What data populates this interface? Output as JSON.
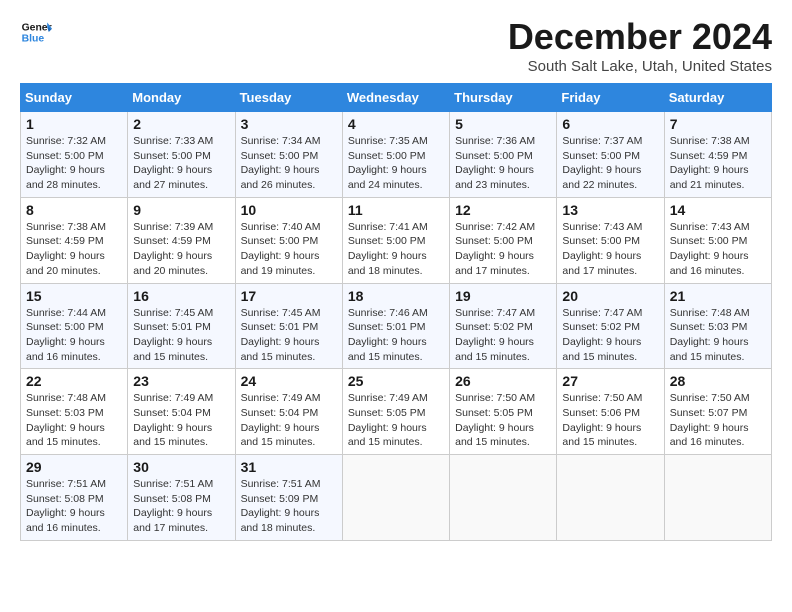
{
  "logo": {
    "line1": "General",
    "line2": "Blue"
  },
  "title": "December 2024",
  "subtitle": "South Salt Lake, Utah, United States",
  "weekdays": [
    "Sunday",
    "Monday",
    "Tuesday",
    "Wednesday",
    "Thursday",
    "Friday",
    "Saturday"
  ],
  "weeks": [
    [
      {
        "day": "1",
        "info": "Sunrise: 7:32 AM\nSunset: 5:00 PM\nDaylight: 9 hours\nand 28 minutes."
      },
      {
        "day": "2",
        "info": "Sunrise: 7:33 AM\nSunset: 5:00 PM\nDaylight: 9 hours\nand 27 minutes."
      },
      {
        "day": "3",
        "info": "Sunrise: 7:34 AM\nSunset: 5:00 PM\nDaylight: 9 hours\nand 26 minutes."
      },
      {
        "day": "4",
        "info": "Sunrise: 7:35 AM\nSunset: 5:00 PM\nDaylight: 9 hours\nand 24 minutes."
      },
      {
        "day": "5",
        "info": "Sunrise: 7:36 AM\nSunset: 5:00 PM\nDaylight: 9 hours\nand 23 minutes."
      },
      {
        "day": "6",
        "info": "Sunrise: 7:37 AM\nSunset: 5:00 PM\nDaylight: 9 hours\nand 22 minutes."
      },
      {
        "day": "7",
        "info": "Sunrise: 7:38 AM\nSunset: 4:59 PM\nDaylight: 9 hours\nand 21 minutes."
      }
    ],
    [
      {
        "day": "8",
        "info": "Sunrise: 7:38 AM\nSunset: 4:59 PM\nDaylight: 9 hours\nand 20 minutes."
      },
      {
        "day": "9",
        "info": "Sunrise: 7:39 AM\nSunset: 4:59 PM\nDaylight: 9 hours\nand 20 minutes."
      },
      {
        "day": "10",
        "info": "Sunrise: 7:40 AM\nSunset: 5:00 PM\nDaylight: 9 hours\nand 19 minutes."
      },
      {
        "day": "11",
        "info": "Sunrise: 7:41 AM\nSunset: 5:00 PM\nDaylight: 9 hours\nand 18 minutes."
      },
      {
        "day": "12",
        "info": "Sunrise: 7:42 AM\nSunset: 5:00 PM\nDaylight: 9 hours\nand 17 minutes."
      },
      {
        "day": "13",
        "info": "Sunrise: 7:43 AM\nSunset: 5:00 PM\nDaylight: 9 hours\nand 17 minutes."
      },
      {
        "day": "14",
        "info": "Sunrise: 7:43 AM\nSunset: 5:00 PM\nDaylight: 9 hours\nand 16 minutes."
      }
    ],
    [
      {
        "day": "15",
        "info": "Sunrise: 7:44 AM\nSunset: 5:00 PM\nDaylight: 9 hours\nand 16 minutes."
      },
      {
        "day": "16",
        "info": "Sunrise: 7:45 AM\nSunset: 5:01 PM\nDaylight: 9 hours\nand 15 minutes."
      },
      {
        "day": "17",
        "info": "Sunrise: 7:45 AM\nSunset: 5:01 PM\nDaylight: 9 hours\nand 15 minutes."
      },
      {
        "day": "18",
        "info": "Sunrise: 7:46 AM\nSunset: 5:01 PM\nDaylight: 9 hours\nand 15 minutes."
      },
      {
        "day": "19",
        "info": "Sunrise: 7:47 AM\nSunset: 5:02 PM\nDaylight: 9 hours\nand 15 minutes."
      },
      {
        "day": "20",
        "info": "Sunrise: 7:47 AM\nSunset: 5:02 PM\nDaylight: 9 hours\nand 15 minutes."
      },
      {
        "day": "21",
        "info": "Sunrise: 7:48 AM\nSunset: 5:03 PM\nDaylight: 9 hours\nand 15 minutes."
      }
    ],
    [
      {
        "day": "22",
        "info": "Sunrise: 7:48 AM\nSunset: 5:03 PM\nDaylight: 9 hours\nand 15 minutes."
      },
      {
        "day": "23",
        "info": "Sunrise: 7:49 AM\nSunset: 5:04 PM\nDaylight: 9 hours\nand 15 minutes."
      },
      {
        "day": "24",
        "info": "Sunrise: 7:49 AM\nSunset: 5:04 PM\nDaylight: 9 hours\nand 15 minutes."
      },
      {
        "day": "25",
        "info": "Sunrise: 7:49 AM\nSunset: 5:05 PM\nDaylight: 9 hours\nand 15 minutes."
      },
      {
        "day": "26",
        "info": "Sunrise: 7:50 AM\nSunset: 5:05 PM\nDaylight: 9 hours\nand 15 minutes."
      },
      {
        "day": "27",
        "info": "Sunrise: 7:50 AM\nSunset: 5:06 PM\nDaylight: 9 hours\nand 15 minutes."
      },
      {
        "day": "28",
        "info": "Sunrise: 7:50 AM\nSunset: 5:07 PM\nDaylight: 9 hours\nand 16 minutes."
      }
    ],
    [
      {
        "day": "29",
        "info": "Sunrise: 7:51 AM\nSunset: 5:08 PM\nDaylight: 9 hours\nand 16 minutes."
      },
      {
        "day": "30",
        "info": "Sunrise: 7:51 AM\nSunset: 5:08 PM\nDaylight: 9 hours\nand 17 minutes."
      },
      {
        "day": "31",
        "info": "Sunrise: 7:51 AM\nSunset: 5:09 PM\nDaylight: 9 hours\nand 18 minutes."
      },
      {
        "day": "",
        "info": ""
      },
      {
        "day": "",
        "info": ""
      },
      {
        "day": "",
        "info": ""
      },
      {
        "day": "",
        "info": ""
      }
    ]
  ]
}
